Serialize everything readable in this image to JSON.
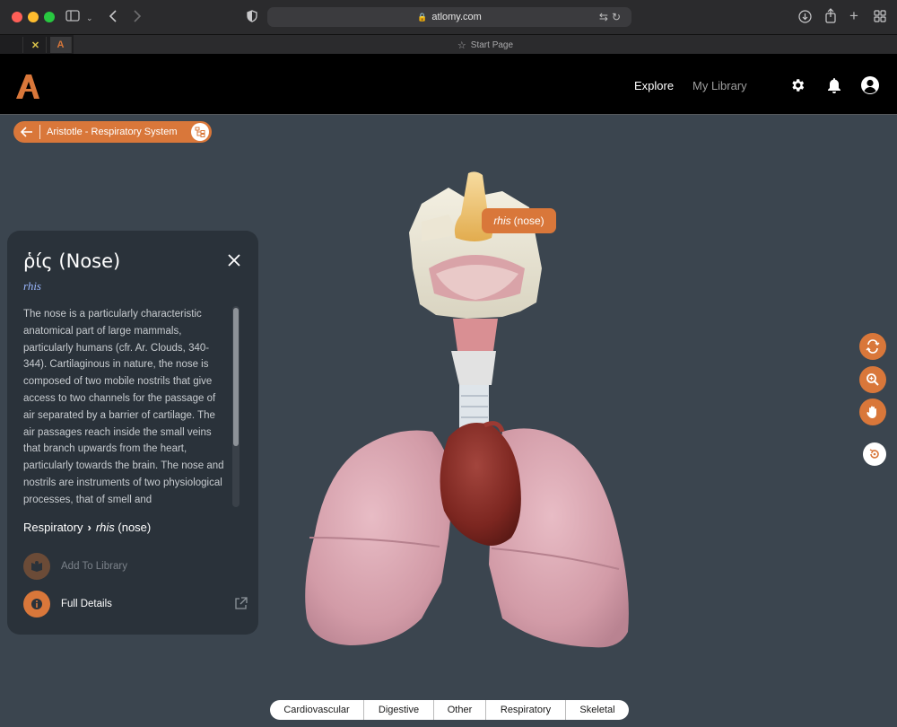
{
  "browser": {
    "url": "atlomy.com",
    "tab_title": "Start Page"
  },
  "header": {
    "logo_letter": "A",
    "nav": [
      {
        "label": "Explore",
        "active": true
      },
      {
        "label": "My Library",
        "active": false
      }
    ]
  },
  "breadcrumb": {
    "title": "Aristotle - Respiratory System"
  },
  "panel": {
    "title": "ῥίς (Nose)",
    "transliteration": "rhis",
    "description": "The nose is a particularly characteristic anatomical part of large mammals, particularly humans (cfr. Ar. Clouds, 340-344). Cartilaginous in nature, the nose is composed of two mobile nostrils that give access to two channels for the passage of air separated by a barrier of cartilage. The air passages reach inside the small veins that branch upwards from the heart, particularly towards the brain. The nose and nostrils are instruments of two physiological processes, that of smell and",
    "path_system": "Respiratory",
    "path_term": "rhis",
    "path_term_gloss": "(nose)",
    "add_to_library": "Add To Library",
    "full_details": "Full Details"
  },
  "tooltip": {
    "term": "rhis",
    "gloss": "(nose)"
  },
  "categories": [
    "Cardiovascular",
    "Digestive",
    "Other",
    "Respiratory",
    "Skeletal"
  ],
  "colors": {
    "accent": "#d9773a",
    "background": "#3b454f",
    "panel": "#2a323a"
  }
}
